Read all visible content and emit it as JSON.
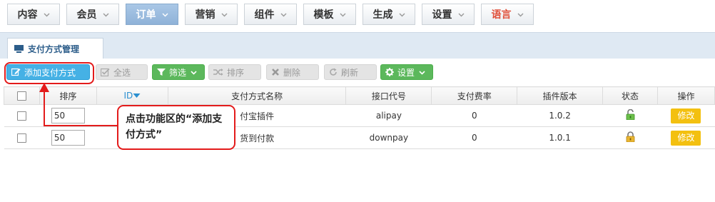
{
  "topnav": {
    "items": [
      {
        "label": "内容"
      },
      {
        "label": "会员"
      },
      {
        "label": "订单"
      },
      {
        "label": "营销"
      },
      {
        "label": "组件"
      },
      {
        "label": "模板"
      },
      {
        "label": "生成"
      },
      {
        "label": "设置"
      },
      {
        "label": "语言"
      }
    ],
    "active_index": 2,
    "highlight_color": "#e0503a"
  },
  "tab": {
    "label": "支付方式管理",
    "icon": "monitor-icon"
  },
  "toolbar": {
    "add_label": "添加支付方式",
    "select_all_label": "全选",
    "filter_label": "筛选",
    "sort_label": "排序",
    "delete_label": "删除",
    "refresh_label": "刷新",
    "settings_label": "设置"
  },
  "table": {
    "headers": [
      "排序",
      "ID",
      "支付方式名称",
      "接口代号",
      "支付费率",
      "插件版本",
      "状态",
      "操作"
    ],
    "rows": [
      {
        "sort": "50",
        "name": "付宝插件",
        "code": "alipay",
        "rate": "0",
        "version": "1.0.2",
        "status": "unlocked",
        "action": "修改"
      },
      {
        "sort": "50",
        "name": "货到付款",
        "code": "downpay",
        "rate": "0",
        "version": "1.0.1",
        "status": "locked",
        "action": "修改"
      }
    ]
  },
  "callout": {
    "text": "点击功能区的“添加支付方式”"
  },
  "colors": {
    "accent": "#45b1e5",
    "annotation": "#e31b1b",
    "edit_button": "#f3c010",
    "green_button": "#5cb85c"
  }
}
